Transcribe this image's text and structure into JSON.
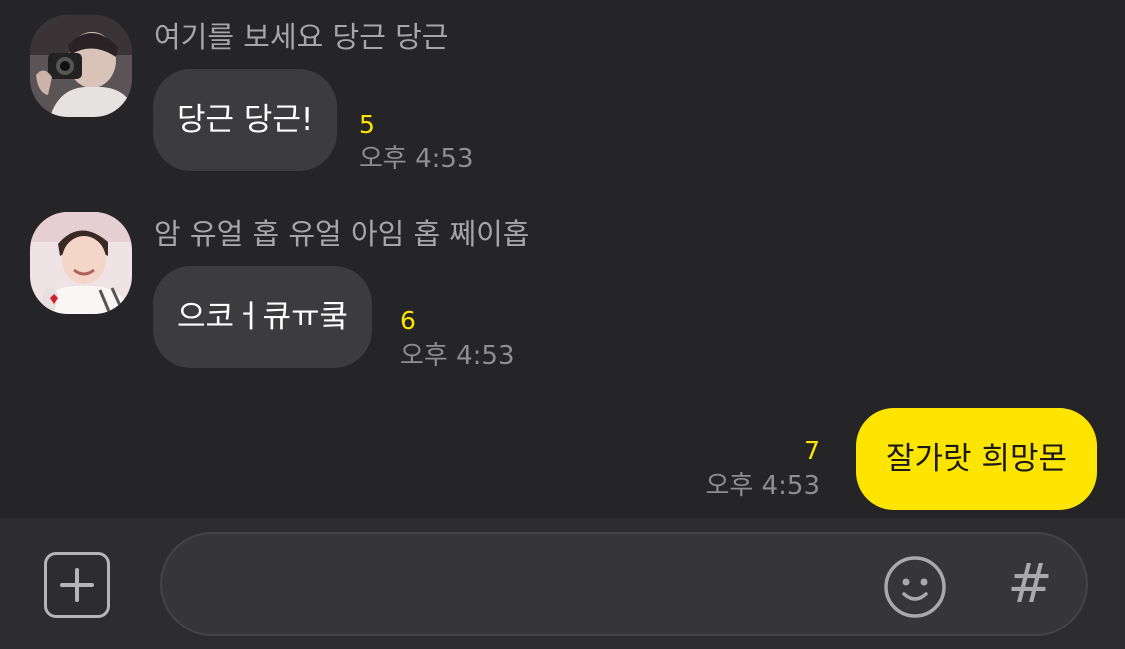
{
  "messages": [
    {
      "sender": "여기를 보세요 당근 당근",
      "text": "당근 당근!",
      "unread": "5",
      "time": "오후 4:53",
      "avatar_icon": "profile-photo-camera"
    },
    {
      "sender": "암 유얼 홉 유얼 아임 홉 쩨이홉",
      "text": "으코ㅓ큐ㅠ쿸",
      "unread": "6",
      "time": "오후 4:53",
      "avatar_icon": "profile-photo-smiling"
    },
    {
      "text": "잘가랏 희망몬",
      "unread": "7",
      "time": "오후 4:53"
    }
  ],
  "input_bar": {
    "plus_icon": "plus-icon",
    "message_value": "",
    "emoji_icon": "smile-icon",
    "hash_label": "#"
  },
  "colors": {
    "background": "#252527",
    "incoming_bubble": "#3c3c3e",
    "outgoing_bubble": "#fee500",
    "unread_count": "#fee500",
    "timestamp": "#8e8e91",
    "sender_name": "#a6a6a8"
  }
}
